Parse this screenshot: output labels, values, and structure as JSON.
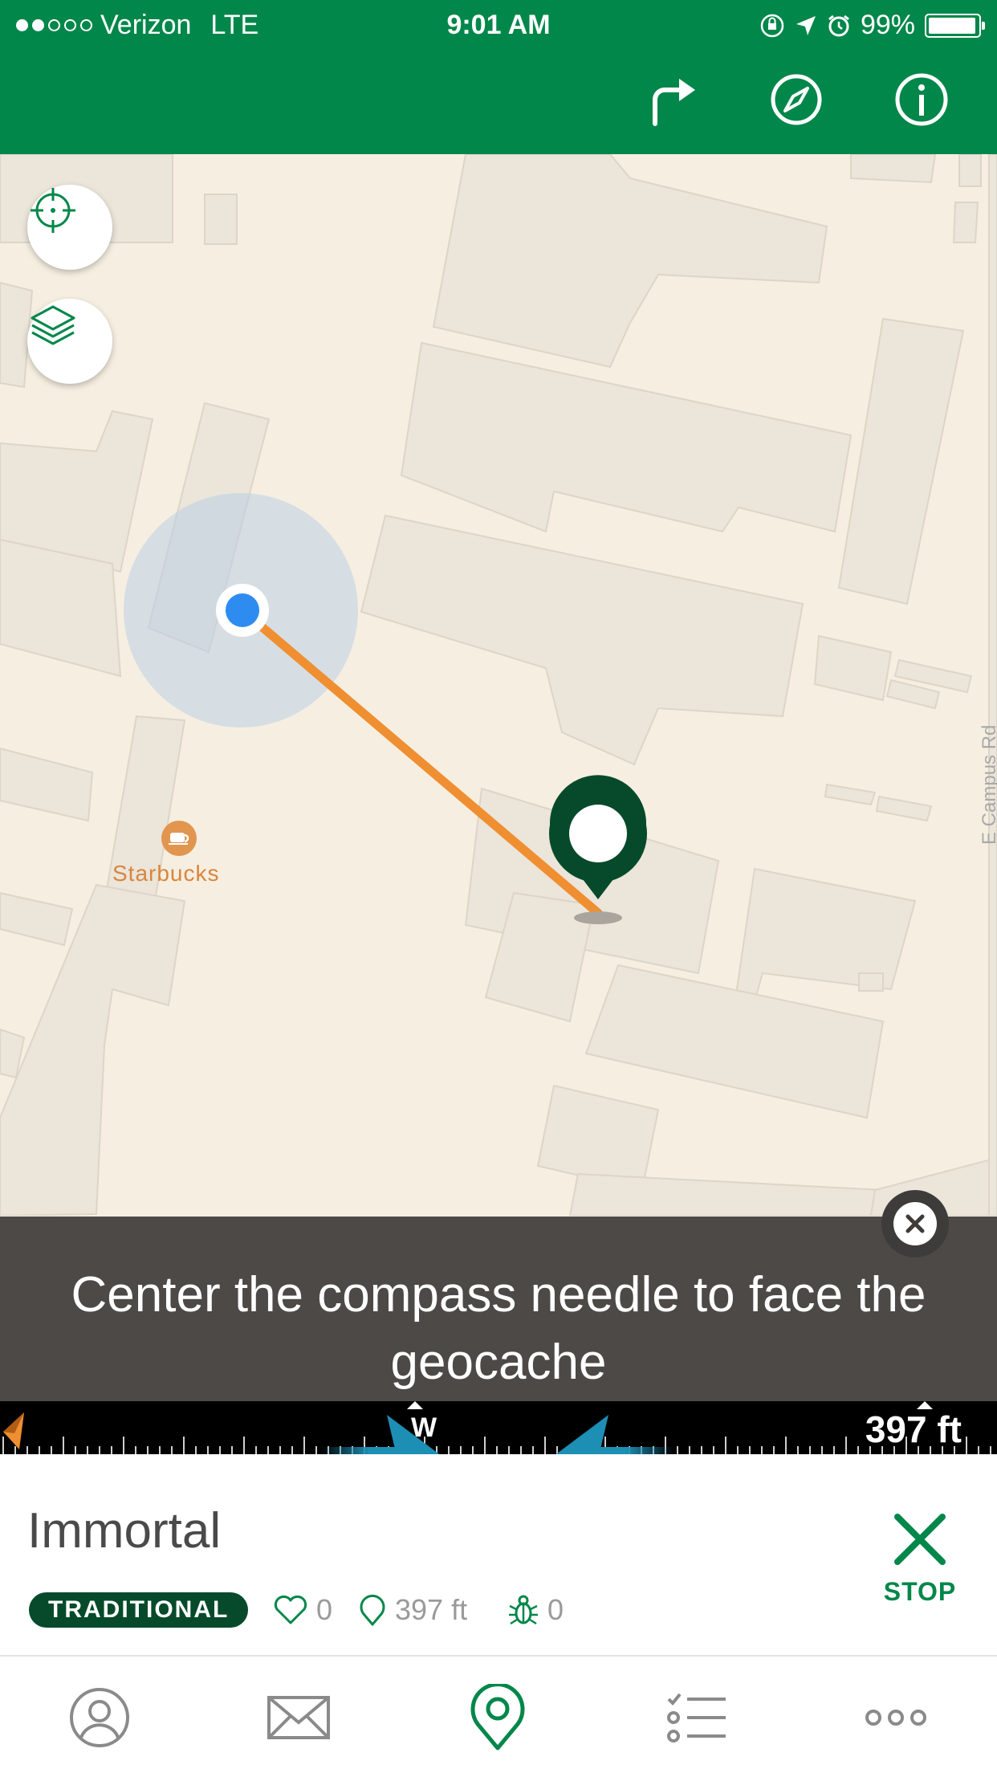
{
  "status_bar": {
    "carrier": "Verizon",
    "network": "LTE",
    "time": "9:01 AM",
    "battery": "99%"
  },
  "header": {
    "icons": [
      "directions-icon",
      "compass-icon",
      "info-icon"
    ]
  },
  "map": {
    "poi_label": "Starbucks",
    "street_label": "E Campus Rd",
    "buttons": [
      "locate-icon",
      "layers-icon"
    ]
  },
  "tip": {
    "message": "Center the compass needle to face the geocache"
  },
  "compass": {
    "heading_label": "W",
    "distance": "397 ft"
  },
  "cache": {
    "name": "Immortal",
    "type": "TRADITIONAL",
    "favorites": "0",
    "distance": "397 ft",
    "trackables": "0"
  },
  "actions": {
    "stop_label": "STOP"
  },
  "tabs": [
    "profile-icon",
    "messages-icon",
    "map-icon",
    "lists-icon",
    "more-icon"
  ],
  "colors": {
    "brand_green": "#02874a",
    "dark_green": "#064a2b",
    "route_orange": "#ef8f31",
    "user_blue": "#2e8cf0",
    "arrow_blue": "#1d8fb4"
  }
}
